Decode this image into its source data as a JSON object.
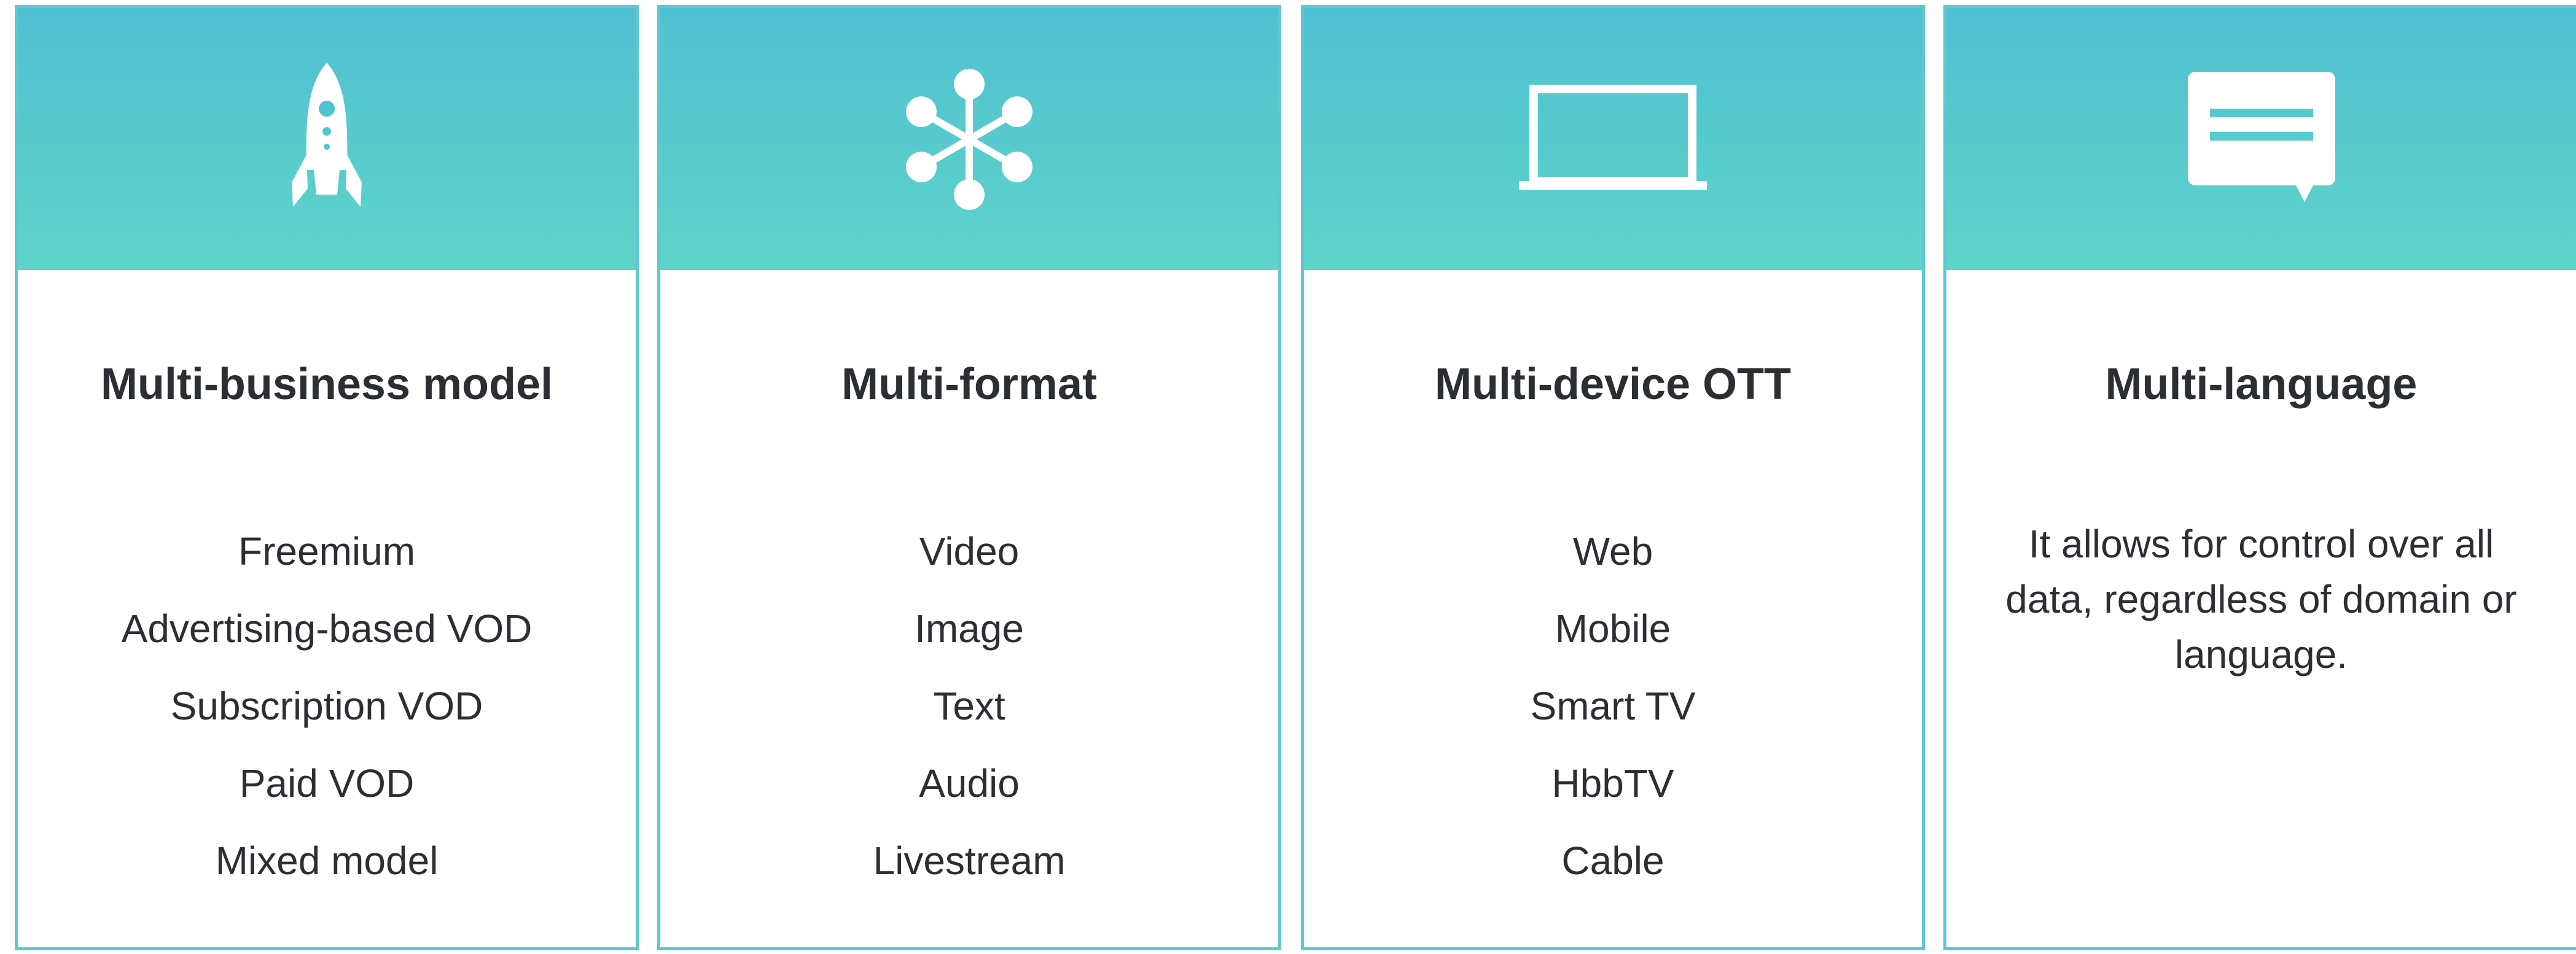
{
  "colors": {
    "header_gradient_top": "#4fc0d2",
    "header_gradient_bottom": "#5fd4c9",
    "border": "#5fc8cf",
    "text": "#2b2f33"
  },
  "cards": [
    {
      "icon": "rocket-icon",
      "title": "Multi-business model",
      "items": [
        "Freemium",
        "Advertising-based VOD",
        "Subscription VOD",
        "Paid VOD",
        "Mixed model"
      ]
    },
    {
      "icon": "network-hub-icon",
      "title": "Multi-format",
      "items": [
        "Video",
        "Image",
        "Text",
        "Audio",
        "Livestream"
      ]
    },
    {
      "icon": "laptop-icon",
      "title": "Multi-device OTT",
      "items": [
        "Web",
        "Mobile",
        "Smart TV",
        "HbbTV",
        "Cable"
      ]
    },
    {
      "icon": "speech-bubble-icon",
      "title": "Multi-language",
      "description": "It allows for control over all data, regardless of domain or language."
    }
  ]
}
